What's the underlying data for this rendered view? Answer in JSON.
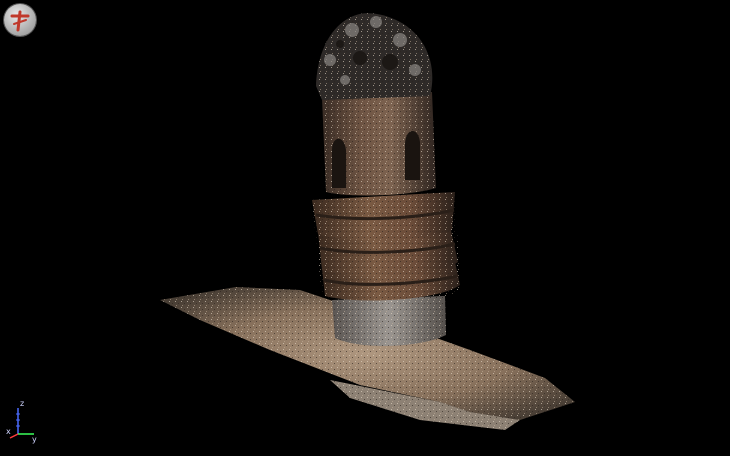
{
  "viewport": {
    "background": "#000000",
    "grid_color": "#3fdede"
  },
  "toolbar": {
    "logo_icon": "app-logo-icon"
  },
  "axis_gizmo": {
    "x_label": "x",
    "y_label": "y",
    "z_label": "z",
    "colors": {
      "x": "#ff3b3b",
      "y": "#3bff5a",
      "z": "#4a6bff"
    }
  },
  "model": {
    "name": "",
    "type": "point-cloud"
  }
}
